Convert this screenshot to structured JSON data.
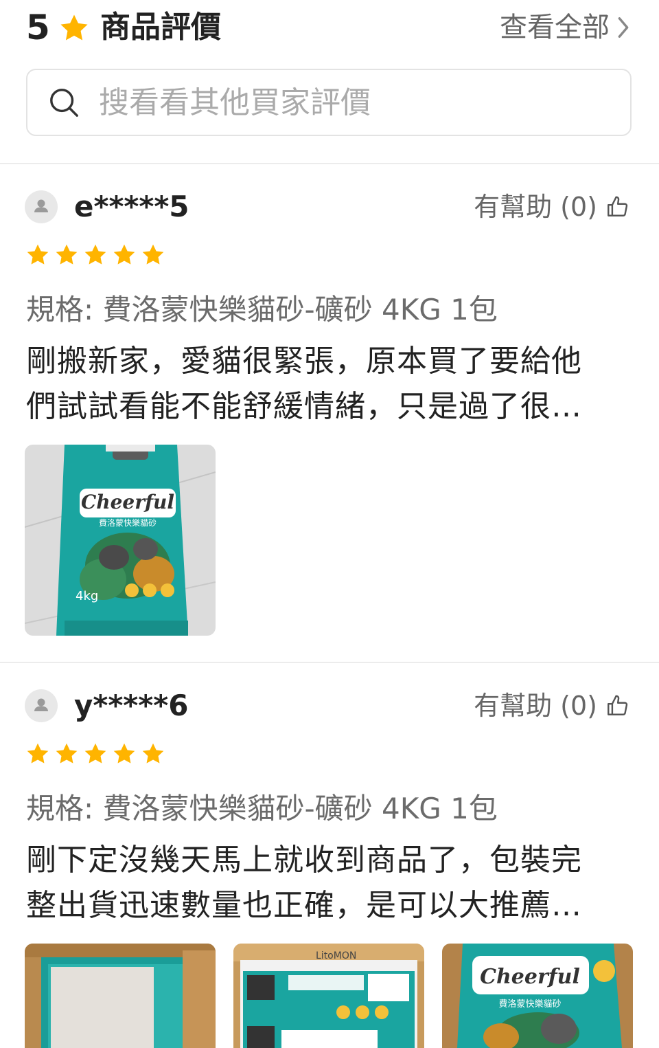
{
  "header": {
    "rating": "5",
    "title": "商品評價",
    "view_all": "查看全部"
  },
  "search": {
    "placeholder": "搜看看其他買家評價"
  },
  "reviews": [
    {
      "username": "e*****5",
      "helpful": "有幫助 (0)",
      "stars": 5,
      "spec": "規格: 費洛蒙快樂貓砂-礦砂 4KG 1包",
      "comment_line1": "剛搬新家，愛貓很緊張，原本買了要給他",
      "comment_line2": "們試試看能不能舒緩情緒，只是過了很…",
      "photo_text": "Cheerful",
      "photo_subtext": "費洛蒙快樂貓砂",
      "photo_weight": "4kg"
    },
    {
      "username": "y*****6",
      "helpful": "有幫助 (0)",
      "stars": 5,
      "spec": "規格: 費洛蒙快樂貓砂-礦砂 4KG 1包",
      "comment_line1": "剛下定沒幾天馬上就收到商品了，包裝完",
      "comment_line2": "整出貨迅速數量也正確，是可以大推薦…",
      "photo2_brand": "LitoMON",
      "photo3_text": "Cheerful",
      "photo3_subtext": "費洛蒙快樂貓砂"
    }
  ],
  "colors": {
    "star": "#FFB400",
    "teal": "#1aa5a0",
    "cardboard": "#c79a5c"
  }
}
